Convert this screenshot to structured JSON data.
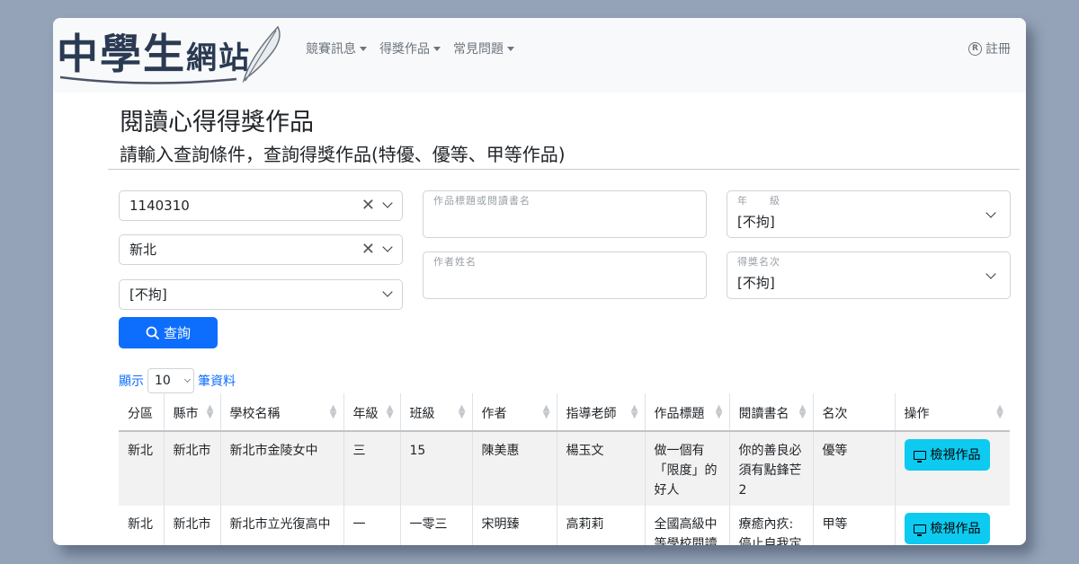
{
  "brand": {
    "logo_main": "中學生",
    "logo_sub": "網站"
  },
  "nav": {
    "items": [
      {
        "label": "競賽訊息"
      },
      {
        "label": "得獎作品"
      },
      {
        "label": "常見問題"
      }
    ],
    "register_icon": "registered-icon",
    "register_label": "註冊"
  },
  "page": {
    "title": "閱讀心得得獎作品",
    "subtitle": "請輸入查詢條件，查詢得獎作品(特優、優等、甲等作品)"
  },
  "filters": {
    "contest": "1140310",
    "city": "新北",
    "school": "[不拘]",
    "title_label": "作品標題或閱讀書名",
    "title_value": "",
    "author_label": "作者姓名",
    "author_value": "",
    "grade_label": "年　　級",
    "grade_value": "[不拘]",
    "rank_label": "得獎名次",
    "rank_value": "[不拘]",
    "query_label": "查詢"
  },
  "length": {
    "prefix": "顯示",
    "value": "10",
    "suffix": "筆資料"
  },
  "table": {
    "headers": [
      "分區",
      "縣市",
      "學校名稱",
      "年級",
      "班級",
      "作者",
      "指導老師",
      "作品標題",
      "閱讀書名",
      "名次",
      "操作"
    ],
    "rows": [
      {
        "area": "新北",
        "county": "新北市",
        "school": "新北市金陵女中",
        "grade": "三",
        "class": "15",
        "author": "陳美惠",
        "teacher": "楊玉文",
        "work_title": "做一個有「限度」的好人",
        "book": "你的善良必須有點鋒芒2",
        "rank": "優等",
        "action": "檢視作品"
      },
      {
        "area": "新北",
        "county": "新北市",
        "school": "新北市立光復高中",
        "grade": "一",
        "class": "一零三",
        "author": "宋明臻",
        "teacher": "高莉莉",
        "work_title": "全國高級中等學校閱讀",
        "book": "療癒內疚:停止自我定",
        "rank": "甲等",
        "action": "檢視作品"
      }
    ]
  },
  "colors": {
    "primary": "#0d6efd",
    "info": "#0dcaf0",
    "navbar_bg": "#f8f9fa",
    "backdrop": "#94a3b8"
  }
}
